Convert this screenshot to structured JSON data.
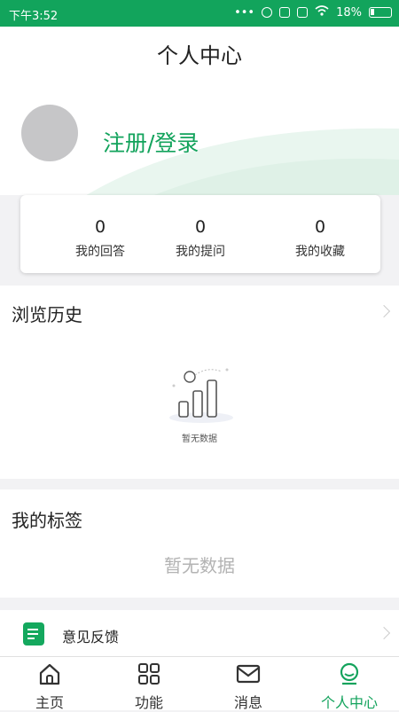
{
  "status_bar": {
    "time": "下午3:52",
    "battery": "18%"
  },
  "header": {
    "title": "个人中心"
  },
  "profile": {
    "login_label": "注册/登录"
  },
  "stats": [
    {
      "count": "0",
      "label": "我的回答"
    },
    {
      "count": "0",
      "label": "我的提问"
    },
    {
      "count": "0",
      "label": "我的收藏"
    }
  ],
  "history": {
    "title": "浏览历史",
    "empty_text": "暂无数据"
  },
  "tags": {
    "title": "我的标签",
    "empty_text": "暂无数据"
  },
  "feedback": {
    "label": "意见反馈"
  },
  "tabbar": {
    "items": [
      {
        "label": "主页",
        "icon": "home-icon"
      },
      {
        "label": "功能",
        "icon": "grid-icon"
      },
      {
        "label": "消息",
        "icon": "mail-icon"
      },
      {
        "label": "个人中心",
        "icon": "user-icon"
      }
    ],
    "active_index": 3
  },
  "colors": {
    "accent": "#13a35c",
    "status_bar": "#12a45c",
    "background": "#f2f2f4"
  }
}
